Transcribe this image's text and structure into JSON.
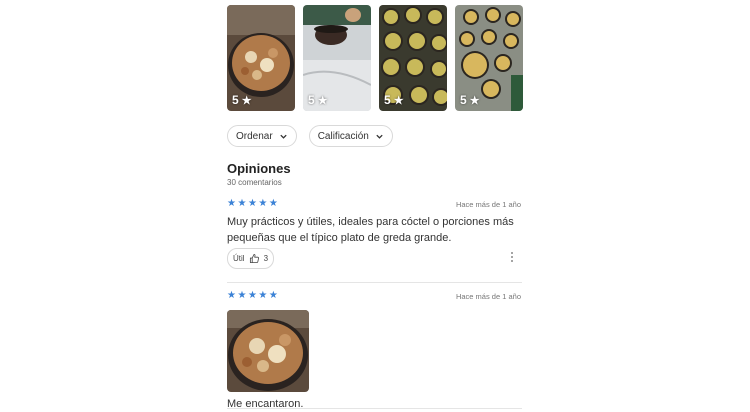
{
  "photos": [
    {
      "rating": "5"
    },
    {
      "rating": "5"
    },
    {
      "rating": "5"
    },
    {
      "rating": "5"
    }
  ],
  "filters": {
    "sort_label": "Ordenar",
    "rating_label": "Calificación"
  },
  "reviews_section": {
    "title": "Opiniones",
    "count": "30 comentarios"
  },
  "reviews": [
    {
      "stars": 5,
      "time": "Hace más de 1 año",
      "text": "Muy prácticos y útiles, ideales para cóctel o porciones más pequeñas que el típico plato de greda grande.",
      "useful_label": "Útil",
      "useful_count": "3"
    },
    {
      "stars": 5,
      "time": "Hace más de 1 año",
      "text": "Me encantaron."
    }
  ],
  "colors": {
    "star": "#3b82d6",
    "border": "#d9d9d9"
  },
  "icons": [
    "star-icon",
    "chevron-down-icon",
    "thumbs-up-icon",
    "more-vertical-icon"
  ]
}
